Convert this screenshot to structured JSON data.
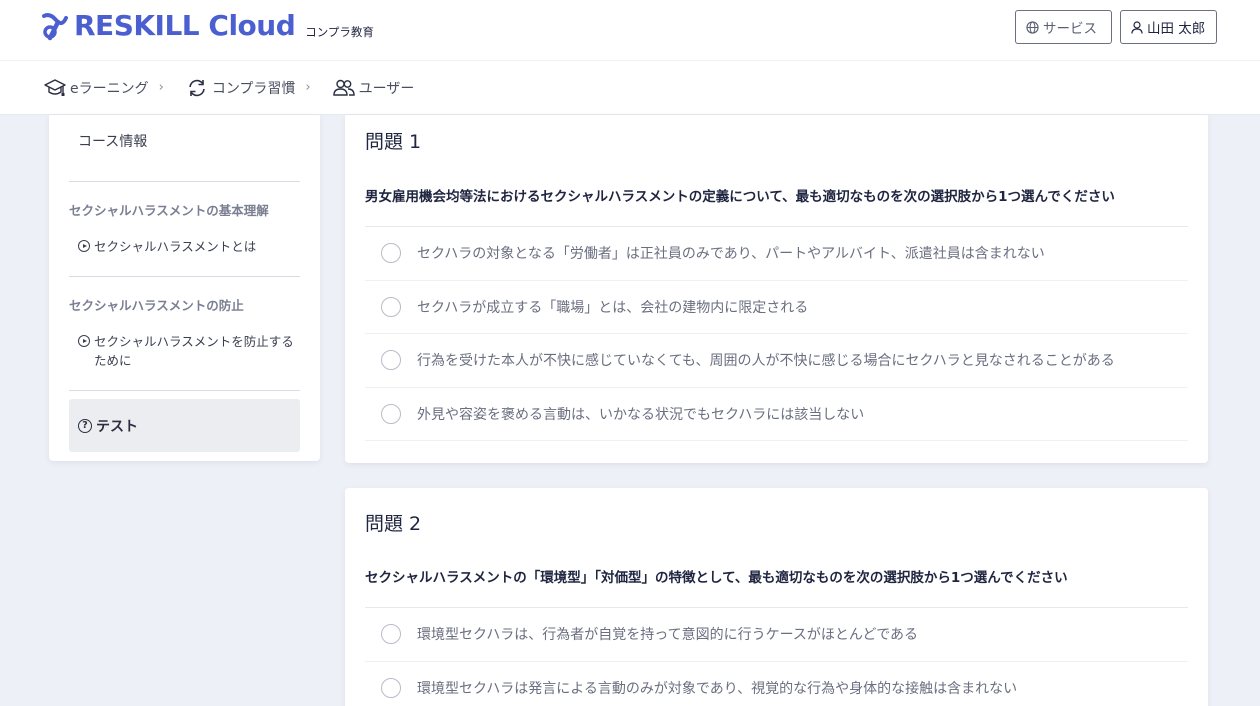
{
  "header": {
    "brand": "RESKILL Cloud",
    "brand_sub": "コンプラ教育",
    "service_label": "サービス",
    "user_label": "山田 太郎"
  },
  "nav": {
    "items": [
      {
        "label": "eラーニング",
        "icon": "graduation-cap-icon"
      },
      {
        "label": "コンプラ習慣",
        "icon": "refresh-icon"
      },
      {
        "label": "ユーザー",
        "icon": "users-icon"
      }
    ]
  },
  "sidebar": {
    "course_info": "コース情報",
    "sections": [
      {
        "title": "セクシャルハラスメントの基本理解",
        "lesson": "セクシャルハラスメントとは"
      },
      {
        "title": "セクシャルハラスメントの防止",
        "lesson": "セクシャルハラスメントを防止するために"
      }
    ],
    "test_label": "テスト",
    "test_icon_glyph": "?"
  },
  "questions": [
    {
      "title": "問題 1",
      "text": "男女雇用機会均等法におけるセクシャルハラスメントの定義について、最も適切なものを次の選択肢から1つ選んでください",
      "options": [
        "セクハラの対象となる「労働者」は正社員のみであり、パートやアルバイト、派遣社員は含まれない",
        "セクハラが成立する「職場」とは、会社の建物内に限定される",
        "行為を受けた本人が不快に感じていなくても、周囲の人が不快に感じる場合にセクハラと見なされることがある",
        "外見や容姿を褒める言動は、いかなる状況でもセクハラには該当しない"
      ]
    },
    {
      "title": "問題 2",
      "text": "セクシャルハラスメントの「環境型」「対価型」の特徴として、最も適切なものを次の選択肢から1つ選んでください",
      "options": [
        "環境型セクハラは、行為者が自覚を持って意図的に行うケースがほとんどである",
        "環境型セクハラは発言による言動のみが対象であり、視覚的な行為や身体的な接触は含まれない"
      ]
    }
  ],
  "colors": {
    "brand": "#4c5fd0",
    "background": "#eef0f8"
  }
}
